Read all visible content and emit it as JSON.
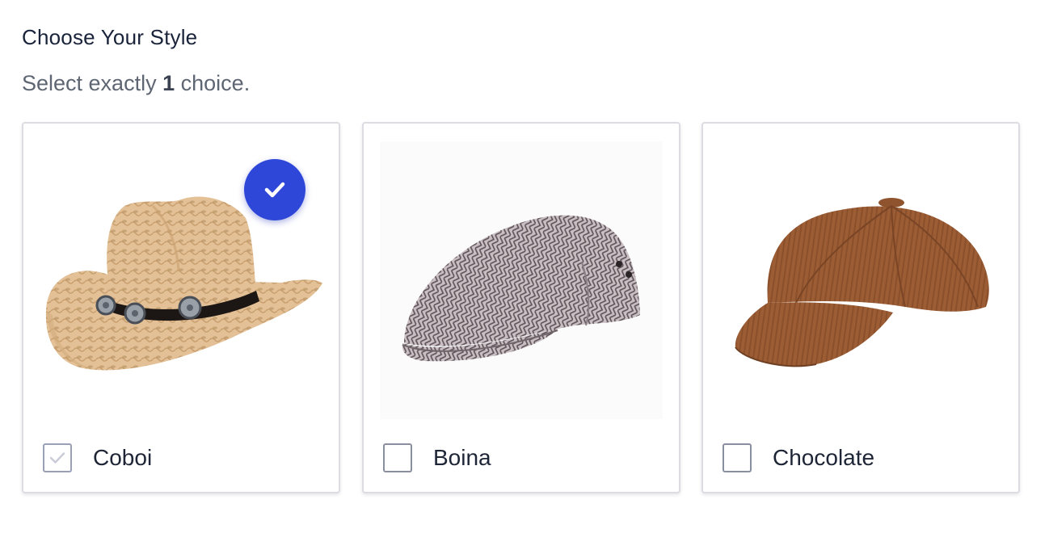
{
  "header": {
    "title": "Choose Your Style",
    "subtitle_prefix": "Select exactly",
    "subtitle_count": "1",
    "subtitle_suffix": "choice."
  },
  "options": [
    {
      "label": "Coboi",
      "selected": true,
      "image": "cowboy-hat"
    },
    {
      "label": "Boina",
      "selected": false,
      "image": "flat-cap"
    },
    {
      "label": "Chocolate",
      "selected": false,
      "image": "newsboy-cap"
    }
  ],
  "colors": {
    "accent": "#2f47d8",
    "card_border": "#dcdde3"
  }
}
